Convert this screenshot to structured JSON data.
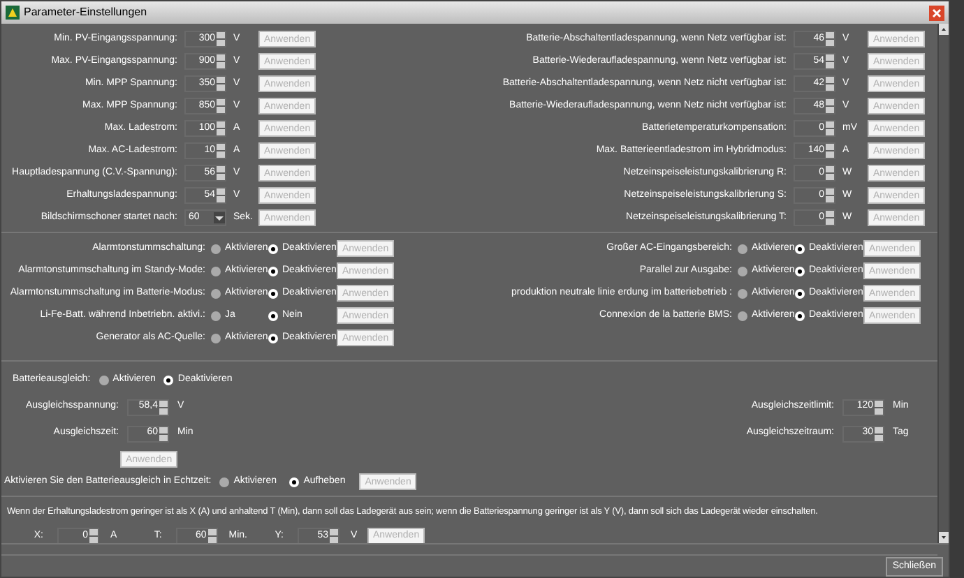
{
  "window": {
    "title": "Parameter-Einstellungen"
  },
  "numeric_settings": {
    "left": [
      {
        "kind": "spinner",
        "label": "Min. PV-Eingangsspannung:",
        "value": "300",
        "unit": "V",
        "button": "Anwenden"
      },
      {
        "kind": "spinner",
        "label": "Max. PV-Eingangsspannung:",
        "value": "900",
        "unit": "V",
        "button": "Anwenden"
      },
      {
        "kind": "spinner",
        "label": "Min. MPP Spannung:",
        "value": "350",
        "unit": "V",
        "button": "Anwenden"
      },
      {
        "kind": "spinner",
        "label": "Max. MPP Spannung:",
        "value": "850",
        "unit": "V",
        "button": "Anwenden"
      },
      {
        "kind": "spinner",
        "label": "Max. Ladestrom:",
        "value": "100",
        "unit": "A",
        "button": "Anwenden"
      },
      {
        "kind": "spinner",
        "label": "Max. AC-Ladestrom:",
        "value": "10",
        "unit": "A",
        "button": "Anwenden"
      },
      {
        "kind": "spinner",
        "label": "Hauptladespannung (C.V.-Spannung):",
        "value": "56",
        "unit": "V",
        "button": "Anwenden"
      },
      {
        "kind": "spinner",
        "label": "Erhaltungsladespannung:",
        "value": "54",
        "unit": "V",
        "button": "Anwenden"
      },
      {
        "kind": "dropdown",
        "label": "Bildschirmschoner startet nach:",
        "value": "60",
        "unit": "Sek.",
        "button": "Anwenden"
      }
    ],
    "right": [
      {
        "kind": "spinner",
        "label": "Batterie-Abschaltentladespannung, wenn Netz verfügbar ist:",
        "value": "46",
        "unit": "V",
        "button": "Anwenden"
      },
      {
        "kind": "spinner",
        "label": "Batterie-Wiederaufladespannung, wenn Netz verfügbar ist:",
        "value": "54",
        "unit": "V",
        "button": "Anwenden"
      },
      {
        "kind": "spinner",
        "label": "Batterie-Abschaltentladespannung, wenn Netz nicht verfügbar ist:",
        "value": "42",
        "unit": "V",
        "button": "Anwenden"
      },
      {
        "kind": "spinner",
        "label": "Batterie-Wiederaufladespannung, wenn Netz nicht verfügbar ist:",
        "value": "48",
        "unit": "V",
        "button": "Anwenden"
      },
      {
        "kind": "spinner",
        "label": "Batterietemperaturkompensation:",
        "value": "0",
        "unit": "mV",
        "button": "Anwenden"
      },
      {
        "kind": "spinner",
        "label": "Max. Batterieentladestrom im Hybridmodus:",
        "value": "140",
        "unit": "A",
        "button": "Anwenden"
      },
      {
        "kind": "spinner",
        "label": "Netzeinspeiseleistungskalibrierung R:",
        "value": "0",
        "unit": "W",
        "button": "Anwenden"
      },
      {
        "kind": "spinner",
        "label": "Netzeinspeiseleistungskalibrierung S:",
        "value": "0",
        "unit": "W",
        "button": "Anwenden"
      },
      {
        "kind": "spinner",
        "label": "Netzeinspeiseleistungskalibrierung T:",
        "value": "0",
        "unit": "W",
        "button": "Anwenden"
      }
    ]
  },
  "toggle_settings": {
    "left": [
      {
        "label": "Alarmtonstummschaltung:",
        "options": [
          {
            "label": "Aktivieren",
            "selected": false
          },
          {
            "label": "Deaktivieren",
            "selected": true
          }
        ],
        "button": "Anwenden"
      },
      {
        "label": "Alarmtonstummschaltung im Standy-Mode:",
        "options": [
          {
            "label": "Aktivieren",
            "selected": false
          },
          {
            "label": "Deaktivieren",
            "selected": true
          }
        ],
        "button": "Anwenden"
      },
      {
        "label": "Alarmtonstummschaltung im Batterie-Modus:",
        "options": [
          {
            "label": "Aktivieren",
            "selected": false
          },
          {
            "label": "Deaktivieren",
            "selected": true
          }
        ],
        "button": "Anwenden"
      },
      {
        "label": "Li-Fe-Batt. während Inbetriebn. aktivi.:",
        "options": [
          {
            "label": "Ja",
            "selected": false
          },
          {
            "label": "Nein",
            "selected": true
          }
        ],
        "button": "Anwenden"
      },
      {
        "label": "Generator als AC-Quelle:",
        "options": [
          {
            "label": "Aktivieren",
            "selected": false
          },
          {
            "label": "Deaktivieren",
            "selected": true
          }
        ],
        "button": "Anwenden"
      }
    ],
    "right": [
      {
        "label": "Großer AC-Eingangsbereich:",
        "options": [
          {
            "label": "Aktivieren",
            "selected": false
          },
          {
            "label": "Deaktivieren",
            "selected": true
          }
        ],
        "button": "Anwenden"
      },
      {
        "label": "Parallel zur Ausgabe:",
        "options": [
          {
            "label": "Aktivieren",
            "selected": false
          },
          {
            "label": "Deaktivieren",
            "selected": true
          }
        ],
        "button": "Anwenden"
      },
      {
        "label": "produktion neutrale linie erdung im batteriebetrieb :",
        "options": [
          {
            "label": "Aktivieren",
            "selected": false
          },
          {
            "label": "Deaktivieren",
            "selected": true
          }
        ],
        "button": "Anwenden"
      },
      {
        "label": "Connexion de la batterie BMS:",
        "options": [
          {
            "label": "Aktivieren",
            "selected": false
          },
          {
            "label": "Deaktivieren",
            "selected": true
          }
        ],
        "button": "Anwenden"
      }
    ]
  },
  "battery_equalization": {
    "label": "Batterieausgleich:",
    "options": [
      {
        "label": "Aktivieren",
        "selected": false
      },
      {
        "label": "Deaktivieren",
        "selected": true
      }
    ],
    "left": [
      {
        "label": "Ausgleichsspannung:",
        "value": "58,4",
        "unit": "V"
      },
      {
        "label": "Ausgleichszeit:",
        "value": "60",
        "unit": "Min"
      }
    ],
    "right": [
      {
        "label": "Ausgleichszeitlimit:",
        "value": "120",
        "unit": "Min"
      },
      {
        "label": "Ausgleichszeitraum:",
        "value": "30",
        "unit": "Tag"
      }
    ],
    "apply_button": "Anwenden",
    "realtime": {
      "label": "Aktivieren Sie den Batterieausgleich in Echtzeit:",
      "options": [
        {
          "label": "Aktivieren",
          "selected": false
        },
        {
          "label": "Aufheben",
          "selected": true
        }
      ],
      "button": "Anwenden"
    }
  },
  "charger_cutoff": {
    "description": "Wenn der Erhaltungsladestrom geringer ist als X (A) und anhaltend T (Min), dann soll das Ladegerät aus sein; wenn die Batteriespannung geringer ist als Y (V), dann soll sich das Ladegerät wieder einschalten.",
    "fields": [
      {
        "label": "X:",
        "value": "0",
        "unit": "A"
      },
      {
        "label": "T:",
        "value": "60",
        "unit": "Min."
      },
      {
        "label": "Y:",
        "value": "53",
        "unit": "V"
      }
    ],
    "button": "Anwenden"
  },
  "close_button": "Schließen"
}
